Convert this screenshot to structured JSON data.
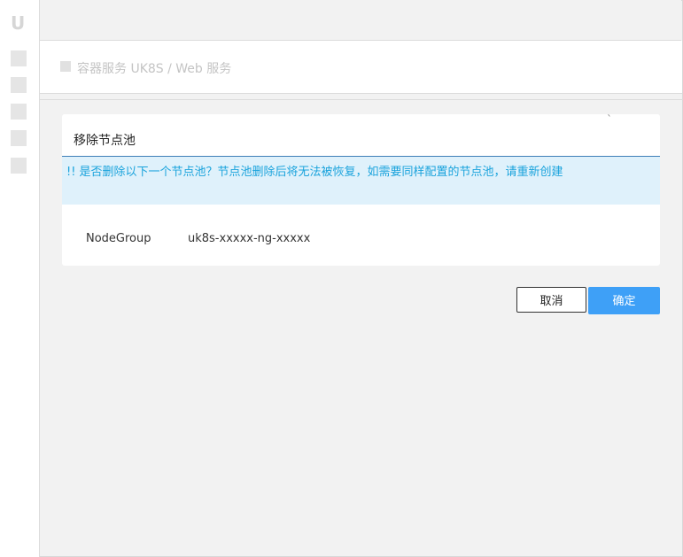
{
  "sidebar": {
    "logo": "U",
    "icons": [
      "nav-item-icon",
      "nav-item-icon",
      "nav-item-icon",
      "nav-item-icon",
      "nav-item-icon"
    ]
  },
  "breadcrumb": {
    "text": "容器服务 UK8S / Web 服务"
  },
  "dialog": {
    "title": "移除节点池",
    "warning": "!! 是否删除以下一个节点池？节点池删除后将无法被恢复，如需要同样配置的节点池，请重新创建",
    "field_label": "NodeGroup",
    "field_value": "uk8s-xxxxx-ng-xxxxx",
    "corner_mark": "`"
  },
  "buttons": {
    "cancel": "取消",
    "confirm": "确定"
  },
  "colors": {
    "accent": "#3ea0f7",
    "warning_bg": "#dff1fb",
    "warning_text": "#1aa3dc"
  }
}
